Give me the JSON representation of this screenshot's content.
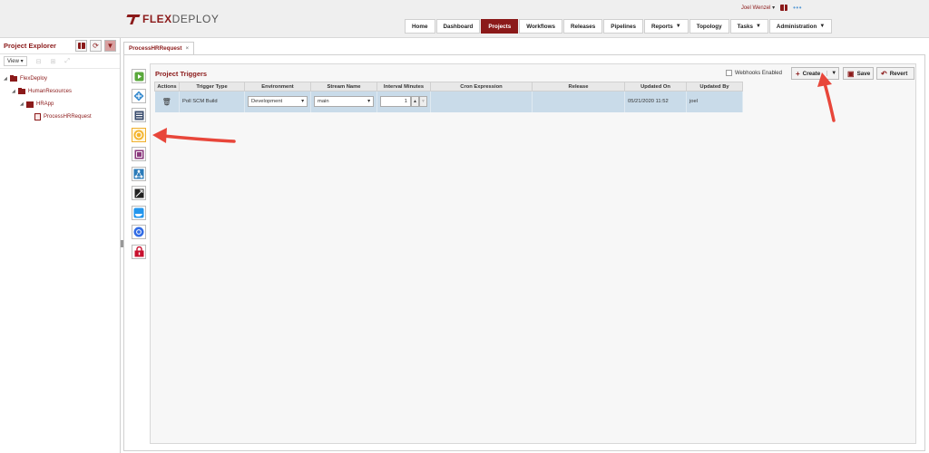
{
  "header": {
    "logo_prefix": "FLEX",
    "logo_suffix": "DEPLOY",
    "user_name": "Joel Wenzel",
    "nav": [
      {
        "label": "Home"
      },
      {
        "label": "Dashboard"
      },
      {
        "label": "Projects",
        "active": true
      },
      {
        "label": "Workflows"
      },
      {
        "label": "Releases"
      },
      {
        "label": "Pipelines"
      },
      {
        "label": "Reports",
        "caret": true
      },
      {
        "label": "Topology"
      },
      {
        "label": "Tasks",
        "caret": true
      },
      {
        "label": "Administration",
        "caret": true
      }
    ]
  },
  "explorer": {
    "title": "Project Explorer",
    "view_label": "View",
    "tree": [
      {
        "label": "FlexDeploy",
        "level": 0,
        "icon": "folder-icon"
      },
      {
        "label": "HumanResources",
        "level": 1,
        "icon": "folder-icon"
      },
      {
        "label": "HRApp",
        "level": 2,
        "icon": "application-icon"
      },
      {
        "label": "ProcessHRRequest",
        "level": 3,
        "icon": "project-icon"
      }
    ]
  },
  "tab": {
    "label": "ProcessHRRequest",
    "close": "×"
  },
  "panel": {
    "title": "Project Triggers",
    "webhooks_label": "Webhooks Enabled",
    "create_label": "Create",
    "save_label": "Save",
    "revert_label": "Revert",
    "columns": [
      "Actions",
      "Trigger Type",
      "Environment",
      "Stream Name",
      "Interval Minutes",
      "Cron Expression",
      "Release",
      "Updated On",
      "Updated By"
    ],
    "rows": [
      {
        "trigger_type": "Poll SCM Build",
        "environment": "Development",
        "stream_name": "main",
        "interval": "1",
        "cron": "",
        "release": "",
        "updated_on": "05/21/2020 11:52",
        "updated_by": "joel"
      }
    ]
  },
  "colors": {
    "brand": "#8b1a1a",
    "selected_row": "#c9dbe9",
    "annotation_arrow": "#e8463a"
  }
}
